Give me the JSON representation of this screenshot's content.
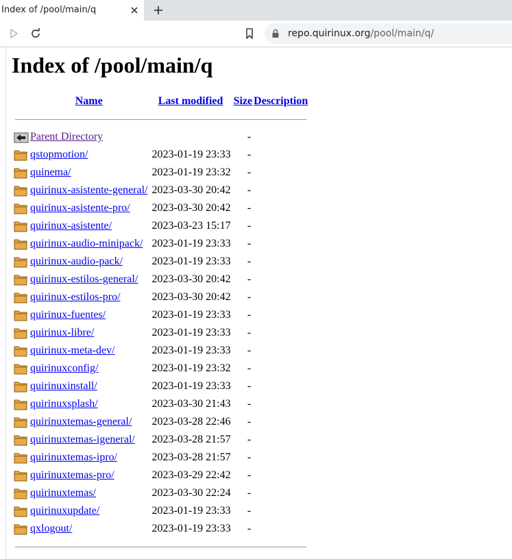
{
  "browser": {
    "tab_title": "Index of /pool/main/q",
    "url_host": "repo.quirinux.org",
    "url_path": "/pool/main/q/"
  },
  "page": {
    "heading": "Index of /pool/main/q",
    "columns": {
      "name": "Name",
      "last_modified": "Last modified",
      "size": "Size",
      "description": "Description"
    },
    "parent": {
      "name": "Parent Directory",
      "size": "-"
    },
    "rows": [
      {
        "name": "qstopmotion/",
        "modified": "2023-01-19 23:33",
        "size": "-"
      },
      {
        "name": "quinema/",
        "modified": "2023-01-19 23:32",
        "size": "-"
      },
      {
        "name": "quirinux-asistente-general/",
        "modified": "2023-03-30 20:42",
        "size": "-"
      },
      {
        "name": "quirinux-asistente-pro/",
        "modified": "2023-03-30 20:42",
        "size": "-"
      },
      {
        "name": "quirinux-asistente/",
        "modified": "2023-03-23 15:17",
        "size": "-"
      },
      {
        "name": "quirinux-audio-minipack/",
        "modified": "2023-01-19 23:33",
        "size": "-"
      },
      {
        "name": "quirinux-audio-pack/",
        "modified": "2023-01-19 23:33",
        "size": "-"
      },
      {
        "name": "quirinux-estilos-general/",
        "modified": "2023-03-30 20:42",
        "size": "-"
      },
      {
        "name": "quirinux-estilos-pro/",
        "modified": "2023-03-30 20:42",
        "size": "-"
      },
      {
        "name": "quirinux-fuentes/",
        "modified": "2023-01-19 23:33",
        "size": "-"
      },
      {
        "name": "quirinux-libre/",
        "modified": "2023-01-19 23:33",
        "size": "-"
      },
      {
        "name": "quirinux-meta-dev/",
        "modified": "2023-01-19 23:33",
        "size": "-"
      },
      {
        "name": "quirinuxconfig/",
        "modified": "2023-01-19 23:32",
        "size": "-"
      },
      {
        "name": "quirinuxinstall/",
        "modified": "2023-01-19 23:33",
        "size": "-"
      },
      {
        "name": "quirinuxsplash/",
        "modified": "2023-03-30 21:43",
        "size": "-"
      },
      {
        "name": "quirinuxtemas-general/",
        "modified": "2023-03-28 22:46",
        "size": "-"
      },
      {
        "name": "quirinuxtemas-igeneral/",
        "modified": "2023-03-28 21:57",
        "size": "-"
      },
      {
        "name": "quirinuxtemas-ipro/",
        "modified": "2023-03-28 21:57",
        "size": "-"
      },
      {
        "name": "quirinuxtemas-pro/",
        "modified": "2023-03-29 22:42",
        "size": "-"
      },
      {
        "name": "quirinuxtemas/",
        "modified": "2023-03-30 22:24",
        "size": "-"
      },
      {
        "name": "quirinuxupdate/",
        "modified": "2023-01-19 23:33",
        "size": "-"
      },
      {
        "name": "qxlogout/",
        "modified": "2023-01-19 23:33",
        "size": "-"
      }
    ]
  },
  "icons": {
    "tab_close": "close-icon",
    "new_tab": "plus-icon",
    "forward": "play-icon",
    "reload": "reload-icon",
    "bookmark": "bookmark-icon",
    "lock": "lock-icon",
    "parent": "back-arrow-icon",
    "entry": "folder-icon"
  },
  "colors": {
    "link": "#0000ee",
    "visited": "#551a8b",
    "folder": "#e8a948"
  }
}
